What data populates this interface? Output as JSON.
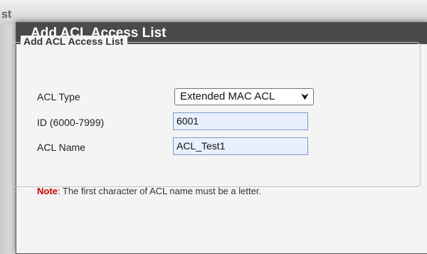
{
  "background": {
    "partial_text": "st"
  },
  "dialog": {
    "title": "Add ACL Access List",
    "section_title": "Add ACL Access List",
    "fields": {
      "acl_type": {
        "label": "ACL Type",
        "value": "Extended MAC ACL"
      },
      "id": {
        "label": "ID (6000-7999)",
        "value": "6001"
      },
      "acl_name": {
        "label": "ACL Name",
        "value": "ACL_Test1"
      }
    },
    "note": {
      "tag": "Note",
      "separator": ":",
      "text": " The first character of ACL name must be a letter."
    }
  },
  "colors": {
    "title_bar": "#4a4a4a",
    "note_tag": "#cc0000",
    "input_fill": "#e8f0fe"
  },
  "icons": {
    "dropdown": "chevron-down-icon"
  }
}
